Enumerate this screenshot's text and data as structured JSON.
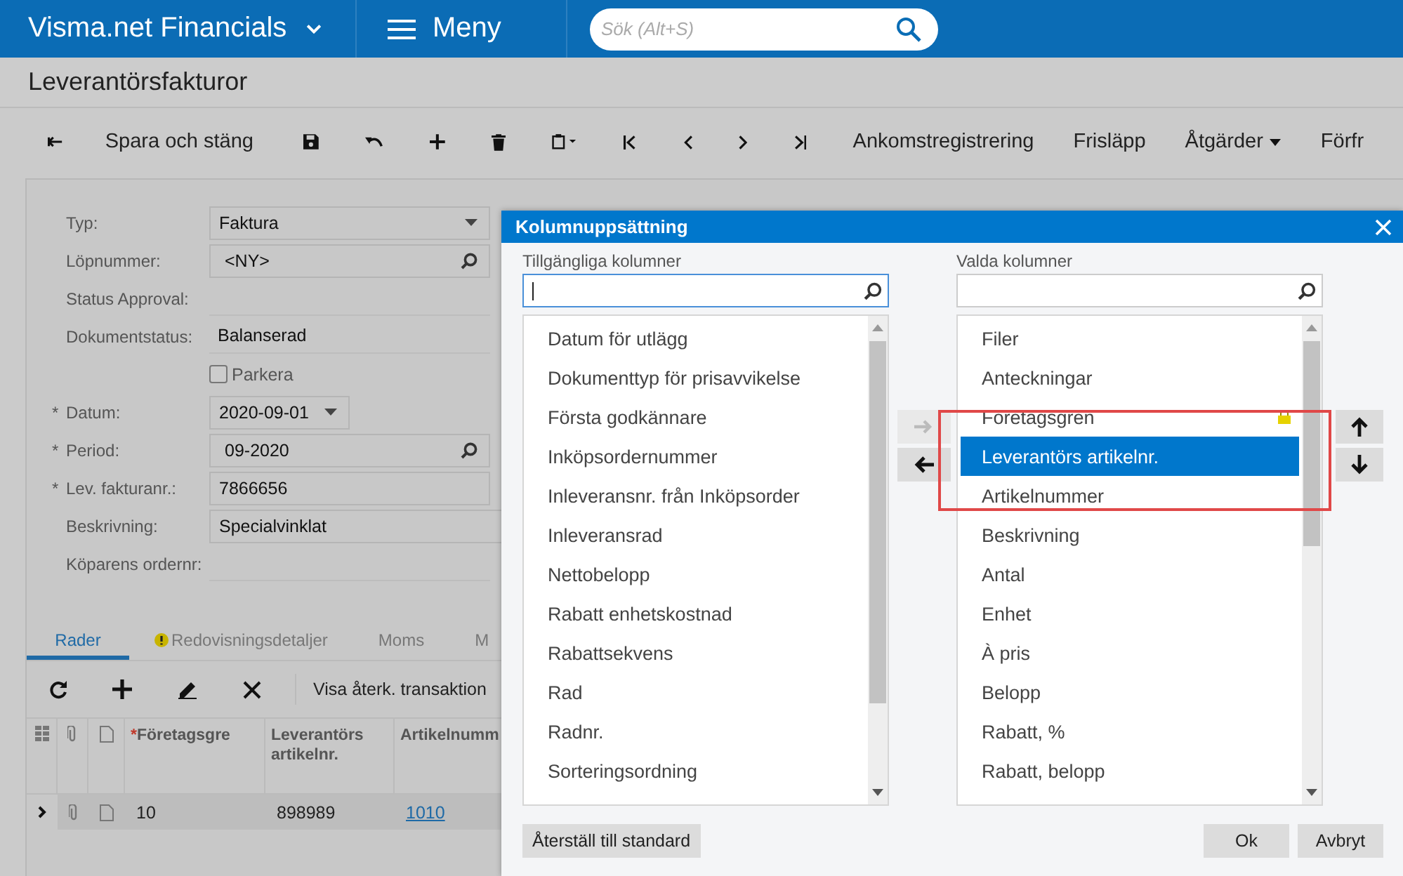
{
  "header": {
    "brand": "Visma.net Financials",
    "menu": "Meny",
    "search_placeholder": "Sök (Alt+S)"
  },
  "page_title": "Leverantörsfakturor",
  "toolbar": {
    "save_close": "Spara och stäng",
    "actions": [
      {
        "label": "Ankomstregistrering",
        "dropdown": false
      },
      {
        "label": "Frisläpp",
        "dropdown": false
      },
      {
        "label": "Åtgärder",
        "dropdown": true
      },
      {
        "label": "Förfr",
        "dropdown": false
      }
    ]
  },
  "form": [
    {
      "kind": "select",
      "label": "Typ:",
      "value": "Faktura"
    },
    {
      "kind": "lookup",
      "label": "Löpnummer:",
      "value": "<NY>"
    },
    {
      "kind": "static",
      "label": "Status Approval:"
    },
    {
      "kind": "static",
      "label": "Dokumentstatus:",
      "value": "Balanserad"
    },
    {
      "kind": "checkbox",
      "label": "Parkera",
      "checked": false
    },
    {
      "kind": "date",
      "label": "Datum:",
      "marker": "*",
      "value": "2020-09-01"
    },
    {
      "kind": "lookup",
      "label": "Period:",
      "marker": "*",
      "value": "09-2020"
    },
    {
      "kind": "text",
      "label": "Lev. fakturanr.:",
      "marker": "*",
      "value": "7866656"
    },
    {
      "kind": "text",
      "label": "Beskrivning:",
      "value": "Specialvinklat"
    },
    {
      "kind": "static",
      "label": "Köparens ordernr:"
    }
  ],
  "tabs": [
    {
      "label": "Rader",
      "selected": true,
      "warning": false
    },
    {
      "label": "Redovisningsdetaljer",
      "selected": false,
      "warning": true
    },
    {
      "label": "Moms",
      "selected": false,
      "warning": false
    },
    {
      "label": "M",
      "selected": false,
      "warning": false
    }
  ],
  "grid": {
    "toolbar_action": "Visa återk. transaktion",
    "columns": [
      {
        "label": "Företagsgre",
        "marker": "*"
      },
      {
        "label": "Leverantörs artikelnr."
      },
      {
        "label": "Artikelnumm"
      }
    ],
    "rows": [
      {
        "cells": [
          "10",
          "898989",
          "1010"
        ]
      }
    ]
  },
  "dialog": {
    "title": "Kolumnuppsättning",
    "available": {
      "label": "Tillgängliga kolumner",
      "items": [
        {
          "label": "Datum för utlägg",
          "selected": false
        },
        {
          "label": "Dokumenttyp för prisavvikelse",
          "selected": false
        },
        {
          "label": "Första godkännare",
          "selected": false
        },
        {
          "label": "Inköpsordernummer",
          "selected": false
        },
        {
          "label": "Inleveransnr. från Inköpsorder",
          "selected": false
        },
        {
          "label": "Inleveransrad",
          "selected": false
        },
        {
          "label": "Nettobelopp",
          "selected": false
        },
        {
          "label": "Rabatt enhetskostnad",
          "selected": false
        },
        {
          "label": "Rabattsekvens",
          "selected": false
        },
        {
          "label": "Rad",
          "selected": false
        },
        {
          "label": "Radnr.",
          "selected": false
        },
        {
          "label": "Sorteringsordning",
          "selected": false
        }
      ]
    },
    "chosen": {
      "label": "Valda kolumner",
      "items": [
        {
          "label": "Filer",
          "selected": false,
          "locked": false
        },
        {
          "label": "Anteckningar",
          "selected": false,
          "locked": false
        },
        {
          "label": "Företagsgren",
          "selected": false,
          "locked": true
        },
        {
          "label": "Leverantörs artikelnr.",
          "selected": true,
          "locked": false
        },
        {
          "label": "Artikelnummer",
          "selected": false,
          "locked": false
        },
        {
          "label": "Beskrivning",
          "selected": false,
          "locked": false
        },
        {
          "label": "Antal",
          "selected": false,
          "locked": false
        },
        {
          "label": "Enhet",
          "selected": false,
          "locked": false
        },
        {
          "label": "À pris",
          "selected": false,
          "locked": false
        },
        {
          "label": "Belopp",
          "selected": false,
          "locked": false
        },
        {
          "label": "Rabatt, %",
          "selected": false,
          "locked": false
        },
        {
          "label": "Rabatt, belopp",
          "selected": false,
          "locked": false
        }
      ]
    },
    "reset": "Återställ till standard",
    "ok": "Ok",
    "cancel": "Avbryt"
  }
}
